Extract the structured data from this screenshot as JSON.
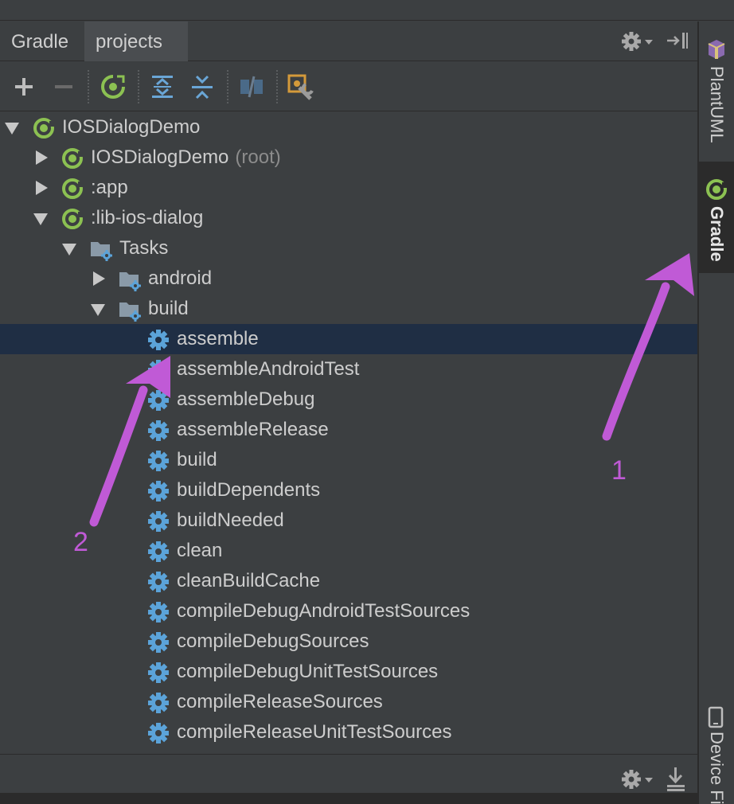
{
  "tool_window": {
    "tabs": [
      {
        "label": "Gradle",
        "active": false
      },
      {
        "label": "projects",
        "active": true
      }
    ],
    "header_actions": [
      "gear-dropdown-icon",
      "hide-panel-icon"
    ],
    "toolbar_buttons": [
      "add-icon",
      "remove-icon",
      "refresh-gradle-icon",
      "expand-all-icon",
      "collapse-all-icon",
      "link-disabled-icon",
      "gradle-settings-icon"
    ]
  },
  "tree": {
    "rows": [
      {
        "label": "IOSDialogDemo",
        "hint": "",
        "icon": "gradle-project-icon",
        "arrow": "down",
        "depth": 0,
        "selected": false
      },
      {
        "label": "IOSDialogDemo",
        "hint": "(root)",
        "icon": "gradle-project-icon",
        "arrow": "right",
        "depth": 1,
        "selected": false
      },
      {
        "label": ":app",
        "hint": "",
        "icon": "gradle-project-icon",
        "arrow": "right",
        "depth": 1,
        "selected": false
      },
      {
        "label": ":lib-ios-dialog",
        "hint": "",
        "icon": "gradle-project-icon",
        "arrow": "down",
        "depth": 1,
        "selected": false
      },
      {
        "label": "Tasks",
        "hint": "",
        "icon": "task-folder-icon",
        "arrow": "down",
        "depth": 2,
        "selected": false
      },
      {
        "label": "android",
        "hint": "",
        "icon": "task-folder-icon",
        "arrow": "right",
        "depth": 3,
        "selected": false
      },
      {
        "label": "build",
        "hint": "",
        "icon": "task-folder-icon",
        "arrow": "down",
        "depth": 3,
        "selected": false
      },
      {
        "label": "assemble",
        "hint": "",
        "icon": "gear-icon",
        "arrow": "none",
        "depth": 4,
        "selected": true
      },
      {
        "label": "assembleAndroidTest",
        "hint": "",
        "icon": "gear-icon",
        "arrow": "none",
        "depth": 4,
        "selected": false
      },
      {
        "label": "assembleDebug",
        "hint": "",
        "icon": "gear-icon",
        "arrow": "none",
        "depth": 4,
        "selected": false
      },
      {
        "label": "assembleRelease",
        "hint": "",
        "icon": "gear-icon",
        "arrow": "none",
        "depth": 4,
        "selected": false
      },
      {
        "label": "build",
        "hint": "",
        "icon": "gear-icon",
        "arrow": "none",
        "depth": 4,
        "selected": false
      },
      {
        "label": "buildDependents",
        "hint": "",
        "icon": "gear-icon",
        "arrow": "none",
        "depth": 4,
        "selected": false
      },
      {
        "label": "buildNeeded",
        "hint": "",
        "icon": "gear-icon",
        "arrow": "none",
        "depth": 4,
        "selected": false
      },
      {
        "label": "clean",
        "hint": "",
        "icon": "gear-icon",
        "arrow": "none",
        "depth": 4,
        "selected": false
      },
      {
        "label": "cleanBuildCache",
        "hint": "",
        "icon": "gear-icon",
        "arrow": "none",
        "depth": 4,
        "selected": false
      },
      {
        "label": "compileDebugAndroidTestSources",
        "hint": "",
        "icon": "gear-icon",
        "arrow": "none",
        "depth": 4,
        "selected": false
      },
      {
        "label": "compileDebugSources",
        "hint": "",
        "icon": "gear-icon",
        "arrow": "none",
        "depth": 4,
        "selected": false
      },
      {
        "label": "compileDebugUnitTestSources",
        "hint": "",
        "icon": "gear-icon",
        "arrow": "none",
        "depth": 4,
        "selected": false
      },
      {
        "label": "compileReleaseSources",
        "hint": "",
        "icon": "gear-icon",
        "arrow": "none",
        "depth": 4,
        "selected": false
      },
      {
        "label": "compileReleaseUnitTestSources",
        "hint": "",
        "icon": "gear-icon",
        "arrow": "none",
        "depth": 4,
        "selected": false
      }
    ]
  },
  "right_sidebar": {
    "items": [
      {
        "label": "PlantUML",
        "icon": "plantuml-icon",
        "active": false
      },
      {
        "label": "Gradle",
        "icon": "gradle-project-icon",
        "active": true
      },
      {
        "label": "Device Fi",
        "icon": "device-icon",
        "active": false
      }
    ]
  },
  "annotations": [
    {
      "label": "1",
      "points_to": "right sidebar Gradle tab"
    },
    {
      "label": "2",
      "points_to": "assemble task"
    }
  ],
  "colors": {
    "panel_bg": "#3c3f41",
    "selection_bg": "#1f2e44",
    "text": "#cdcdcd",
    "hint_text": "#8c8c8c",
    "gradle_green": "#8cc152",
    "gear_blue": "#5ba3d9",
    "annotation_purple": "#c05ad6"
  }
}
